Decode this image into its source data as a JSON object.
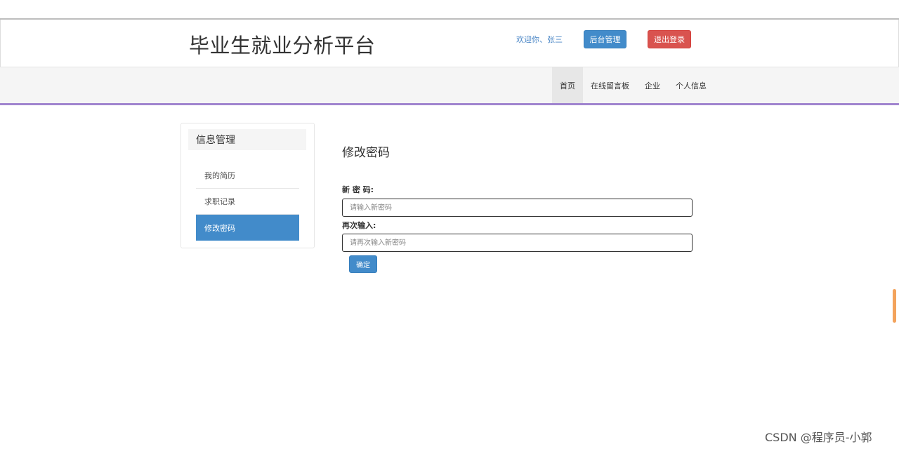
{
  "header": {
    "title": "毕业生就业分析平台",
    "welcome": "欢迎你、张三",
    "admin_button": "后台管理",
    "logout_button": "退出登录"
  },
  "nav": {
    "items": [
      "首页",
      "在线留言板",
      "企业",
      "个人信息"
    ],
    "active": "首页"
  },
  "sidebar": {
    "heading": "信息管理",
    "items": [
      "我的简历",
      "求职记录",
      "修改密码"
    ],
    "active": "修改密码"
  },
  "form": {
    "heading": "修改密码",
    "new_password_label": "新 密 码:",
    "new_password_placeholder": "请输入新密码",
    "confirm_label": "再次输入:",
    "confirm_placeholder": "请再次输入新密码",
    "submit_label": "确定"
  },
  "watermark": "CSDN @程序员-小郭",
  "colors": {
    "primary": "#428bca",
    "danger": "#d9534f",
    "nav_accent": "#a084cf"
  }
}
